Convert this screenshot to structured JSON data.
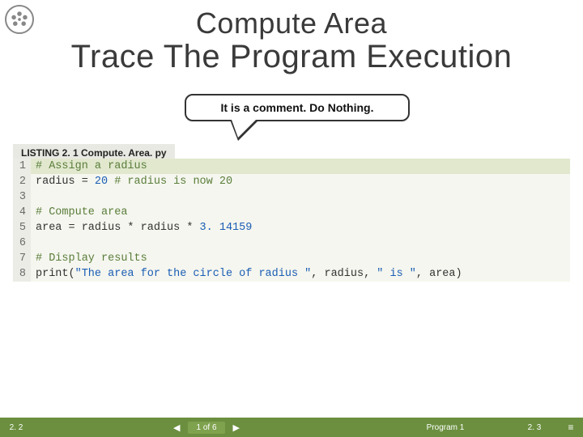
{
  "header": {
    "title_line1": "Compute Area",
    "title_line2": "Trace The Program Execution"
  },
  "callout": {
    "text": "It is a comment. Do Nothing."
  },
  "listing": {
    "label": "LISTING 2. 1 Compute. Area. py",
    "lines": [
      {
        "n": "1",
        "comment": "# Assign a radius",
        "highlight": true
      },
      {
        "n": "2",
        "plain1": "radius = ",
        "num1": "20",
        "plain2": " ",
        "comment": "# radius is now 20"
      },
      {
        "n": "3",
        "plain1": ""
      },
      {
        "n": "4",
        "comment": "# Compute area"
      },
      {
        "n": "5",
        "plain1": "area = radius * radius * ",
        "num1": "3. 14159"
      },
      {
        "n": "6",
        "plain1": ""
      },
      {
        "n": "7",
        "comment": "# Display results"
      },
      {
        "n": "8",
        "plain1": "print(",
        "str1": "\"The area for the circle of radius \"",
        "plain2": ", radius, ",
        "str2": "\" is \"",
        "plain3": ", area)"
      }
    ]
  },
  "footer": {
    "left": "2. 2",
    "counter": "1 of 6",
    "program_label": "Program 1",
    "right": "2. 3",
    "prev_icon": "◀",
    "next_icon": "▶",
    "menu_icon": "≡"
  }
}
